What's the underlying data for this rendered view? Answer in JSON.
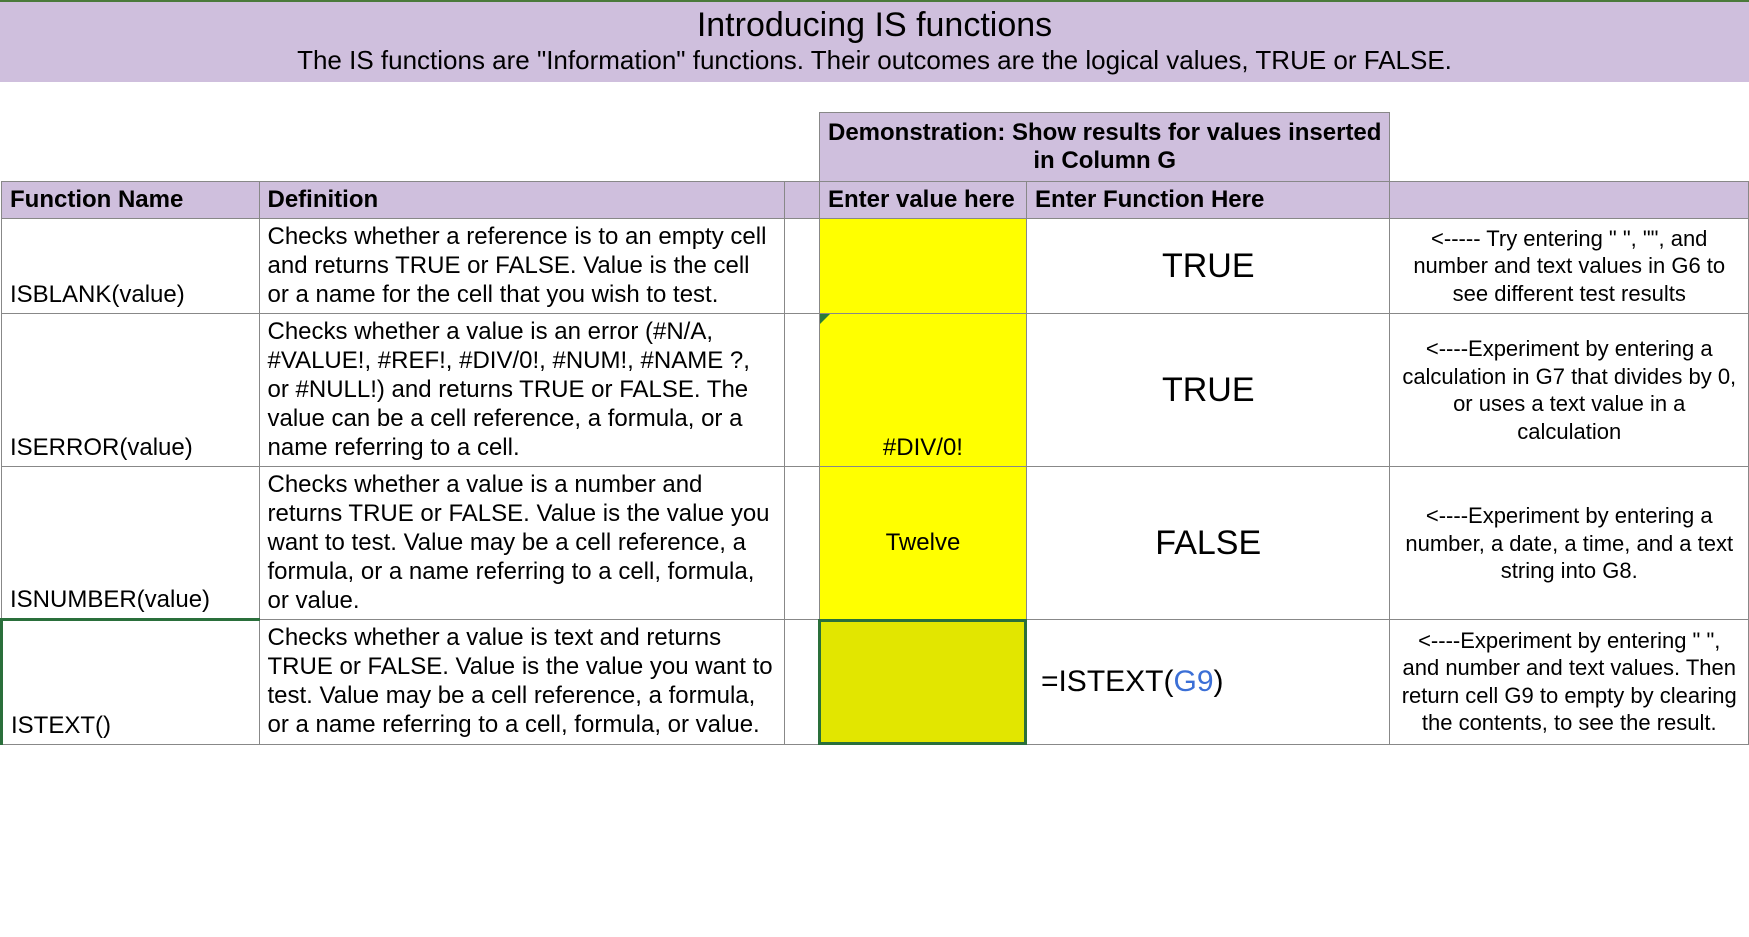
{
  "header": {
    "title": "Introducing IS functions",
    "subtitle": "The IS functions are \"Information\" functions. Their outcomes are the logical values, TRUE or FALSE."
  },
  "columns": {
    "function_name": "Function Name",
    "definition": "Definition",
    "demo_header": "Demonstration: Show results for values inserted in Column G",
    "enter_value": "Enter value here",
    "enter_function": "Enter Function Here"
  },
  "rows": [
    {
      "fn": "ISBLANK(value)",
      "def": "Checks whether a reference is to an empty cell and returns TRUE or FALSE. Value is the cell or a name for the cell that you wish to test.",
      "value": "",
      "result": "TRUE",
      "tip": "<----- Try entering \" \", \"\", and number and text values in G6 to see different test results"
    },
    {
      "fn": "ISERROR(value)",
      "def": "Checks whether a value is an error (#N/A, #VALUE!, #REF!, #DIV/0!, #NUM!, #NAME ?, or #NULL!) and returns TRUE or FALSE. The value can be a cell reference, a formula, or a name referring to a cell.",
      "value": "#DIV/0!",
      "result": "TRUE",
      "tip": "<----Experiment by entering a calculation in G7 that divides by 0, or uses a text value in a calculation"
    },
    {
      "fn": "ISNUMBER(value)",
      "def": "Checks whether a value is a number and returns TRUE or FALSE. Value is the value you want to test. Value may be a cell reference, a formula, or a name referring to a cell, formula, or value.",
      "value": "Twelve",
      "result": "FALSE",
      "tip": "<----Experiment by entering a number, a date, a time, and a text string into G8."
    },
    {
      "fn": "ISTEXT()",
      "def": "Checks whether a value is text and returns TRUE or FALSE. Value is the value you want to test. Value may be a cell reference, a formula, or a name referring to a cell, formula, or value.",
      "value": "",
      "result_pre": "=ISTEXT(",
      "result_ref": "G9",
      "result_post": ")",
      "tip": "<----Experiment by entering \" \", and number and text values. Then return cell G9 to empty by clearing the contents, to see the result."
    }
  ]
}
